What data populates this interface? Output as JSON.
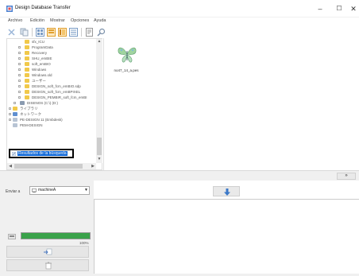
{
  "window": {
    "title": "Design Database Transfer",
    "controls": {
      "minimize": "–",
      "maximize": "☐",
      "close": "✕"
    }
  },
  "menu": {
    "items": [
      "Archivo",
      "Edición",
      "Mostrar",
      "Opciones",
      "Ayuda"
    ]
  },
  "toolbar": {
    "icons": [
      "cut-icon",
      "copy-icon",
      "view-large-icon",
      "view-medium-icon",
      "view-list-icon",
      "properties-icon",
      "search-icon"
    ]
  },
  "tree": {
    "rows": [
      "sfx_ICU",
      "ProgramData",
      "Recovery",
      "SHU_emBIE",
      "soft_emBIO",
      "Windows",
      "Windows.old",
      "ユーザー",
      "DESIGN_soft_fcm_emBIO.sdp",
      "DESIGN_soft_fcm_emBPIXEL",
      "DESIGN_PEMBIR_soft_fcm_emBI",
      "DISENOS (C:\\) (D:)",
      "ライブラリ",
      "ネットワーク",
      "PE-DESIGN 11 (Embdesk)",
      "PEM-DESIGN"
    ],
    "search_results_label": "Resultados de la búsqueda"
  },
  "thumbnail": {
    "filename": "no47_14_a.pes"
  },
  "bottom": {
    "send_label": "Enviar a",
    "machine_value": "machineA",
    "progress_percent": 100,
    "progress_text": "100%"
  },
  "colors": {
    "accent": "#0a64d6",
    "folder": "#f1c94a",
    "progress": "#3aa24a",
    "transfer_arrow": "#3b78c8"
  }
}
